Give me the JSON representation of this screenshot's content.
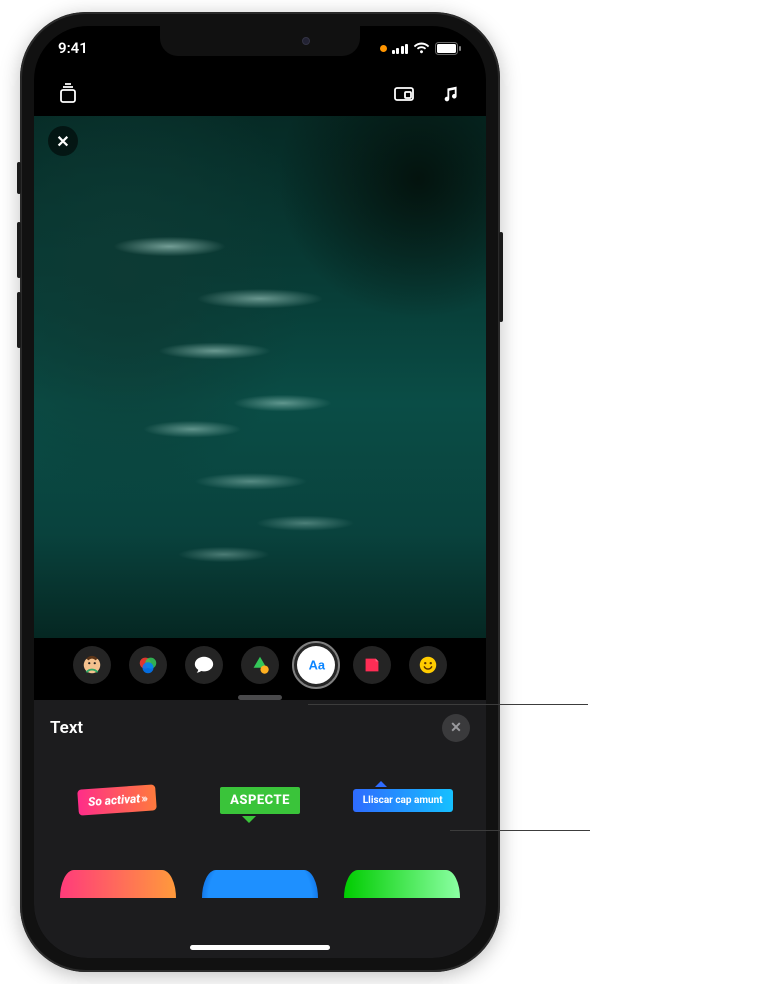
{
  "status": {
    "time": "9:41"
  },
  "topbar": {
    "library_icon": "library-icon",
    "aspect_icon": "aspect-icon",
    "music_icon": "music-icon"
  },
  "viewer": {
    "close_label": "✕"
  },
  "effects": {
    "items": [
      {
        "name": "memoji-icon"
      },
      {
        "name": "filters-icon"
      },
      {
        "name": "messages-bubble-icon"
      },
      {
        "name": "shapes-icon"
      },
      {
        "name": "text-aa-icon",
        "selected": true
      },
      {
        "name": "sticker-icon"
      },
      {
        "name": "emoji-icon"
      }
    ]
  },
  "sheet": {
    "title": "Text",
    "close_label": "✕",
    "styles": [
      {
        "label": "So activat"
      },
      {
        "label": "ASPECTE"
      },
      {
        "label": "Lliscar cap amunt"
      }
    ]
  }
}
